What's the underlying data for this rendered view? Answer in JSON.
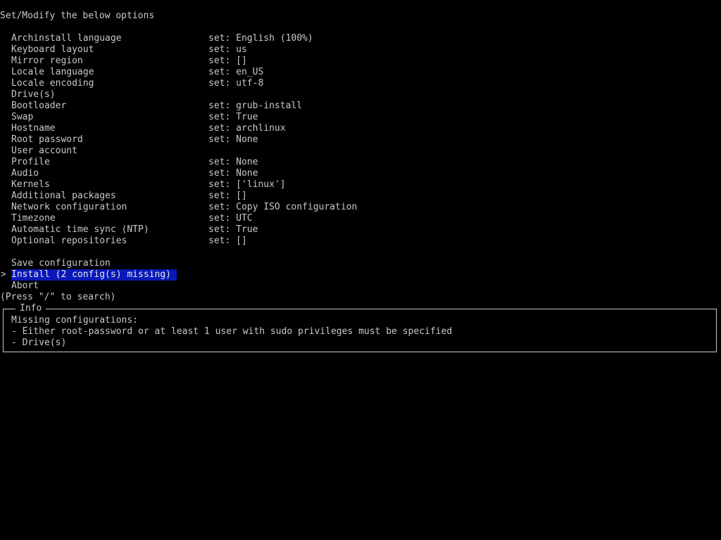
{
  "header": "Set/Modify the below options",
  "options": [
    {
      "label": "Archinstall language",
      "value": "set: English (100%)"
    },
    {
      "label": "Keyboard layout",
      "value": "set: us"
    },
    {
      "label": "Mirror region",
      "value": "set: []"
    },
    {
      "label": "Locale language",
      "value": "set: en_US"
    },
    {
      "label": "Locale encoding",
      "value": "set: utf-8"
    },
    {
      "label": "Drive(s)",
      "value": ""
    },
    {
      "label": "Bootloader",
      "value": "set: grub-install"
    },
    {
      "label": "Swap",
      "value": "set: True"
    },
    {
      "label": "Hostname",
      "value": "set: archlinux"
    },
    {
      "label": "Root password",
      "value": "set: None"
    },
    {
      "label": "User account",
      "value": ""
    },
    {
      "label": "Profile",
      "value": "set: None"
    },
    {
      "label": "Audio",
      "value": "set: None"
    },
    {
      "label": "Kernels",
      "value": "set: ['linux']"
    },
    {
      "label": "Additional packages",
      "value": "set: []"
    },
    {
      "label": "Network configuration",
      "value": "set: Copy ISO configuration"
    },
    {
      "label": "Timezone",
      "value": "set: UTC"
    },
    {
      "label": "Automatic time sync (NTP)",
      "value": "set: True"
    },
    {
      "label": "Optional repositories",
      "value": "set: []"
    }
  ],
  "actions": {
    "save": "Save configuration",
    "install": "Install (2 config(s) missing)",
    "abort": "Abort",
    "cursor": ">"
  },
  "search_hint": "(Press \"/\" to search)",
  "info": {
    "title": "Info",
    "heading": "Missing configurations:",
    "items": [
      "- Either root-password or at least 1 user with sudo privileges must be specified",
      "- Drive(s)"
    ]
  },
  "colors": {
    "background": "#000000",
    "text": "#c8c8c8",
    "selection": "#0a18b8"
  }
}
